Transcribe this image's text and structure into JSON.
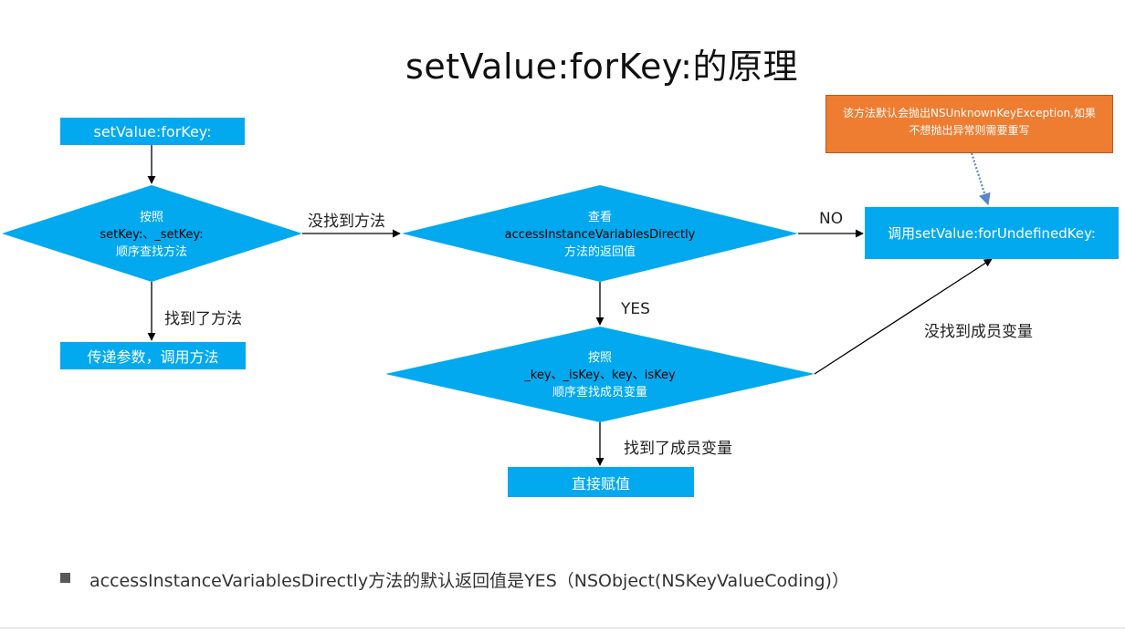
{
  "title": "setValue:forKey:的原理",
  "nodes": {
    "start": "setValue:forKey:",
    "decision1": {
      "line1": "按照",
      "line2": "setKey:、_setKey:",
      "line3": "顺序查找方法"
    },
    "pass_params": "传递参数，调用方法",
    "decision2": {
      "line1": "查看",
      "line2": "accessInstanceVariablesDirectly",
      "line3": "方法的返回值"
    },
    "undefined_key": "调用setValue:forUndefinedKey:",
    "decision3": {
      "line1": "按照",
      "line2": "_key、_isKey、key、isKey",
      "line3": "顺序查找成员变量"
    },
    "assign": "直接赋值",
    "note": {
      "line1": "该方法默认会抛出NSUnknownKeyException,如果",
      "line2": "不想抛出异常则需要重写"
    }
  },
  "edges": {
    "method_not_found": "没找到方法",
    "method_found": "找到了方法",
    "no": "NO",
    "yes": "YES",
    "ivar_not_found": "没找到成员变量",
    "ivar_found": "找到了成员变量"
  },
  "bullet": "accessInstanceVariablesDirectly方法的默认返回值是YES（NSObject(NSKeyValueCoding)）",
  "colors": {
    "node_fill": "#02a9ef",
    "note_fill": "#ee7d32",
    "note_border": "#b85a1c"
  }
}
